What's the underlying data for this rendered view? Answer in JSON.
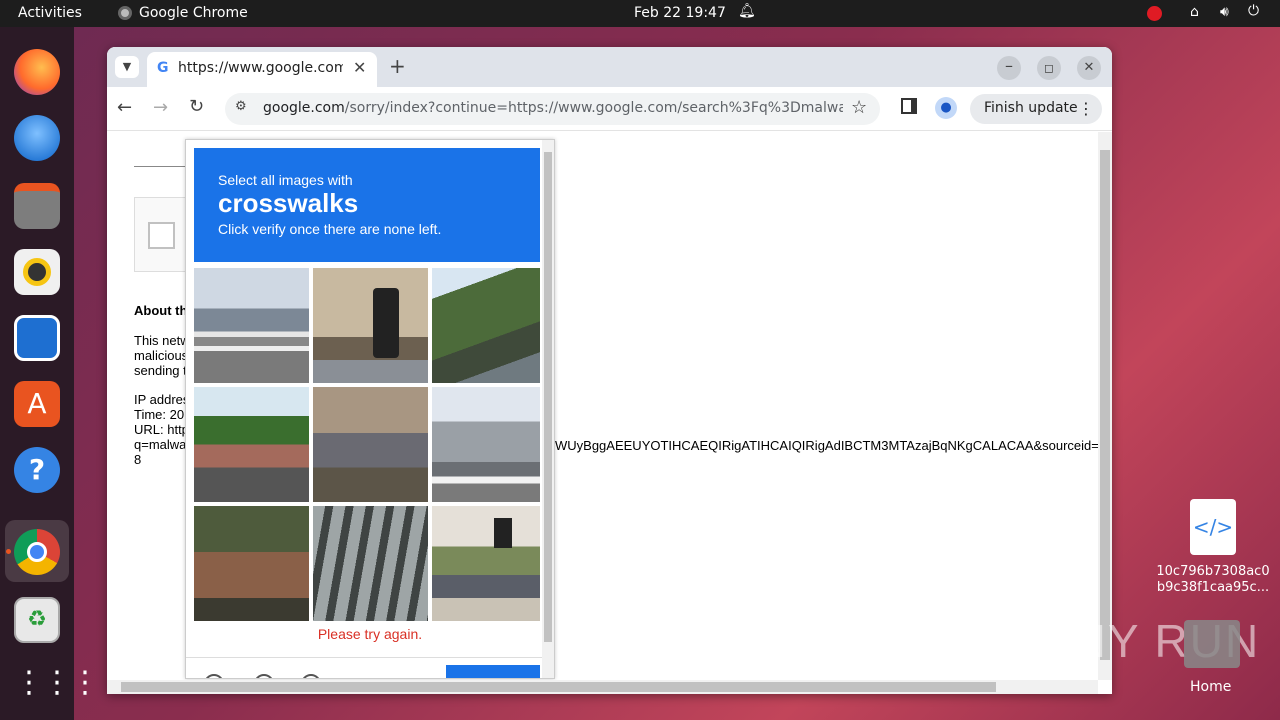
{
  "topbar": {
    "activities": "Activities",
    "app_name": "Google Chrome",
    "datetime": "Feb 22  19:47"
  },
  "browser": {
    "tab_title": "https://www.google.com",
    "url_host": "google.com",
    "url_rest": "/sorry/index?continue=https://www.google.com/search%3Fq%3Dmalwarebaz...",
    "finish_update": "Finish update"
  },
  "page": {
    "about_heading": "About th",
    "about_lines": [
      "This netw",
      "malicious",
      "sending t"
    ],
    "ip_lines": [
      "IP addres",
      "Time: 20",
      "URL: http",
      "q=malwa",
      "8"
    ],
    "url_tail": "WUyBggAEEUYOTIHCAEQIRigATIHCAIQIRigAdIBCTM3MTAzajBqNKgCALACAA&sourceid=c"
  },
  "captcha": {
    "instruction_small": "Select all images with",
    "target_word": "crosswalks",
    "instruction_sub": "Click verify once there are none left.",
    "error": "Please try again.",
    "tiles": [
      "bus-crosswalk",
      "traffic-light-building",
      "flowers-street",
      "car-red-crosswalk",
      "scooter-closeup",
      "building-crosswalk",
      "stone-steps",
      "bridge-underside",
      "traffic-light-street"
    ]
  },
  "desktop": {
    "file_name_line1": "10c796b7308ac0",
    "file_name_line2": "b9c38f1caa95c...",
    "home_label": "Home",
    "watermark": "ANY RUN"
  },
  "colors": {
    "captcha_blue": "#1a73e8",
    "error_red": "#d93025"
  }
}
